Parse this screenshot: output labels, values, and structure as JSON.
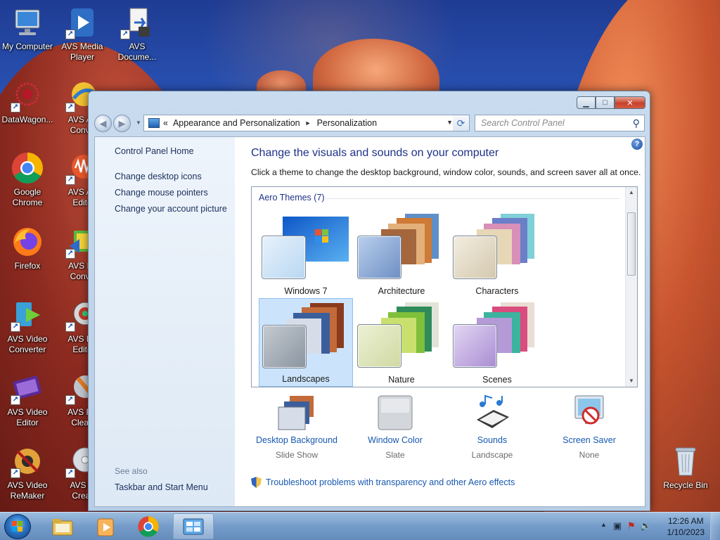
{
  "desktop": {
    "icons_left": [
      {
        "label": "My Computer",
        "icon": "computer-icon"
      },
      {
        "label": "DataWagon...",
        "icon": "datawagon-icon"
      },
      {
        "label": "Google Chrome",
        "icon": "chrome-icon"
      },
      {
        "label": "Firefox",
        "icon": "firefox-icon"
      },
      {
        "label": "AVS Video Converter",
        "icon": "avs-video-converter-icon"
      },
      {
        "label": "AVS Video Editor",
        "icon": "avs-video-editor-icon"
      },
      {
        "label": "AVS Video ReMaker",
        "icon": "avs-video-remaker-icon"
      }
    ],
    "icons_second": [
      {
        "label": "AVS Media Player",
        "icon": "avs-media-player-icon"
      },
      {
        "label": "AVS Au\nConve",
        "icon": "avs-audio-converter-icon"
      },
      {
        "label": "AVS Au\nEdito",
        "icon": "avs-audio-editor-icon"
      },
      {
        "label": "AVS Im\nConve",
        "icon": "avs-image-converter-icon"
      },
      {
        "label": "AVS Ph\nEdito",
        "icon": "avs-photo-editor-icon"
      },
      {
        "label": "AVS Re\nClean",
        "icon": "avs-registry-cleaner-icon"
      },
      {
        "label": "AVS D\nCreat",
        "icon": "avs-disc-creator-icon"
      }
    ],
    "icon_avs_document": {
      "label": "AVS Docume...",
      "icon": "avs-document-converter-icon"
    },
    "recycle_bin": {
      "label": "Recycle Bin",
      "icon": "recycle-bin-icon"
    }
  },
  "window": {
    "controls": {
      "minimize": "▁",
      "maximize": "□",
      "close": "✕"
    },
    "address": {
      "prefix": "«",
      "segments": [
        "Appearance and Personalization",
        "Personalization"
      ],
      "separator": "►",
      "dropdown": "▼"
    },
    "refresh": "⟳",
    "search": {
      "placeholder": "Search Control Panel",
      "icon": "🔍"
    },
    "help": "?",
    "left_pane": {
      "home": "Control Panel Home",
      "links": [
        "Change desktop icons",
        "Change mouse pointers",
        "Change your account picture"
      ],
      "see_also_heading": "See also",
      "see_also_links": [
        "Taskbar and Start Menu"
      ]
    },
    "main": {
      "title": "Change the visuals and sounds on your computer",
      "description": "Click a theme to change the desktop background, window color, sounds, and screen saver all at once.",
      "group_heading": "Aero Themes (7)",
      "themes": [
        {
          "name": "Windows 7",
          "selected": false,
          "colors": [
            "#1560c9",
            "#4ea5ec"
          ]
        },
        {
          "name": "Architecture",
          "selected": false,
          "colors": [
            "#c0642a",
            "#6a9ad0"
          ]
        },
        {
          "name": "Characters",
          "selected": false,
          "colors": [
            "#c8b089",
            "#6fb7d6"
          ]
        },
        {
          "name": "Landscapes",
          "selected": true,
          "colors": [
            "#d7dde8",
            "#8a3b1c"
          ]
        },
        {
          "name": "Nature",
          "selected": false,
          "colors": [
            "#6aa83b",
            "#c9e06f"
          ]
        },
        {
          "name": "Scenes",
          "selected": false,
          "colors": [
            "#8d6cc4",
            "#d94c7d"
          ]
        }
      ],
      "settings": [
        {
          "label": "Desktop Background",
          "value": "Slide Show",
          "icon": "desktop-background-icon"
        },
        {
          "label": "Window Color",
          "value": "Slate",
          "icon": "window-color-icon"
        },
        {
          "label": "Sounds",
          "value": "Landscape",
          "icon": "sounds-icon"
        },
        {
          "label": "Screen Saver",
          "value": "None",
          "icon": "screen-saver-icon"
        }
      ],
      "troubleshoot": "Troubleshoot problems with transparency and other Aero effects"
    }
  },
  "taskbar": {
    "clock": {
      "time": "12:26 AM",
      "date": "1/10/2023"
    },
    "tray_arrow": "▲"
  }
}
